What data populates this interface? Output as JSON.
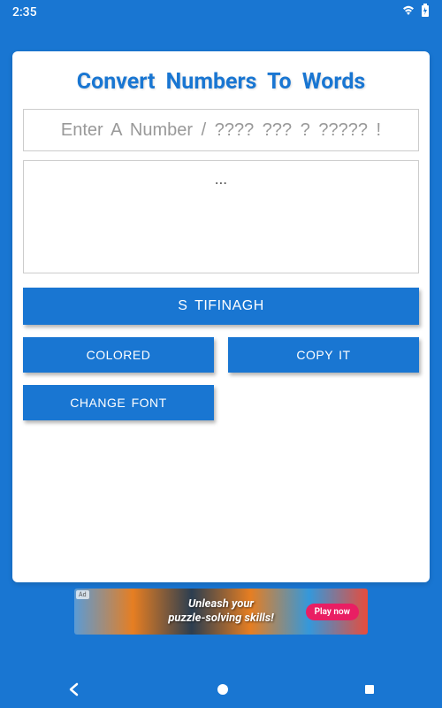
{
  "status": {
    "time": "2:35"
  },
  "card": {
    "title": "Convert Numbers To Words",
    "input_placeholder": "Enter A Number / ???? ??? ? ????? !",
    "output_text": "...",
    "buttons": {
      "tifinagh": "S TIFINAGH",
      "colored": "COLORED",
      "copy": "COPY IT",
      "change_font": "CHANGE FONT"
    }
  },
  "ad": {
    "badge": "Ad",
    "text_line1": "Unleash your",
    "text_line2": "puzzle-solving skills!",
    "cta": "Play now"
  }
}
